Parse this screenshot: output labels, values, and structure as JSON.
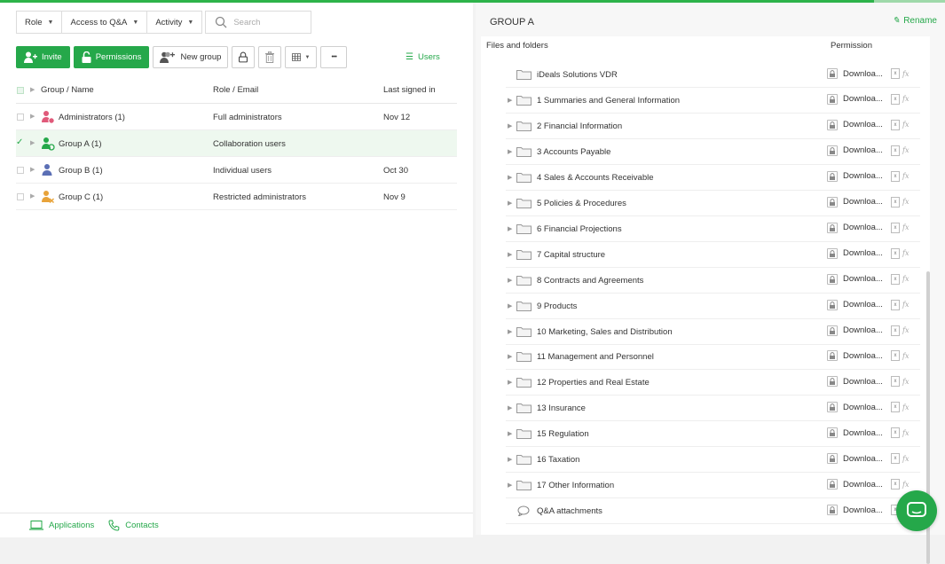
{
  "colors": {
    "accent": "#25a84a",
    "selected_row": "#eef8ef"
  },
  "filters": {
    "role": "Role",
    "access": "Access to Q&A",
    "activity": "Activity",
    "search_placeholder": "Search"
  },
  "toolbar": {
    "invite": "Invite",
    "permissions": "Permissions",
    "new_group": "New group",
    "more": "•••",
    "users": "Users"
  },
  "table": {
    "headers": {
      "name": "Group / Name",
      "role": "Role / Email",
      "last": "Last signed in"
    },
    "rows": [
      {
        "name": "Administrators (1)",
        "role": "Full administrators",
        "last": "Nov 12",
        "icon": "admin-group-icon",
        "color": "#e05a7a"
      },
      {
        "name": "Group A (1)",
        "role": "Collaboration users",
        "last": "",
        "icon": "collab-group-icon",
        "color": "#25a84a"
      },
      {
        "name": "Group B (1)",
        "role": "Individual users",
        "last": "Oct 30",
        "icon": "user-icon",
        "color": "#5b6fb5"
      },
      {
        "name": "Group C (1)",
        "role": "Restricted administrators",
        "last": "Nov 9",
        "icon": "restricted-admin-icon",
        "color": "#e8a33a"
      }
    ]
  },
  "footer": {
    "applications": "Applications",
    "contacts": "Contacts"
  },
  "right": {
    "title": "GROUP A",
    "rename": "Rename",
    "col_files": "Files and folders",
    "col_permission": "Permission",
    "permission_label": "Downloa...",
    "xls_icon": "x",
    "fx_label": "fx",
    "items": [
      {
        "name": "iDeals Solutions VDR",
        "type": "root"
      },
      {
        "name": "1 Summaries and General Information",
        "type": "folder"
      },
      {
        "name": "2 Financial Information",
        "type": "folder"
      },
      {
        "name": "3 Accounts Payable",
        "type": "folder"
      },
      {
        "name": "4 Sales & Accounts Receivable",
        "type": "folder"
      },
      {
        "name": "5 Policies & Procedures",
        "type": "folder"
      },
      {
        "name": "6 Financial Projections",
        "type": "folder"
      },
      {
        "name": "7 Capital structure",
        "type": "folder"
      },
      {
        "name": "8 Contracts and Agreements",
        "type": "folder"
      },
      {
        "name": "9 Products",
        "type": "folder"
      },
      {
        "name": "10 Marketing, Sales and Distribution",
        "type": "folder"
      },
      {
        "name": "11 Management and Personnel",
        "type": "folder"
      },
      {
        "name": "12 Properties and Real Estate",
        "type": "folder"
      },
      {
        "name": "13 Insurance",
        "type": "folder"
      },
      {
        "name": "15 Regulation",
        "type": "folder"
      },
      {
        "name": "16 Taxation",
        "type": "folder"
      },
      {
        "name": "17 Other Information",
        "type": "folder"
      },
      {
        "name": "Q&A attachments",
        "type": "qa"
      }
    ]
  }
}
